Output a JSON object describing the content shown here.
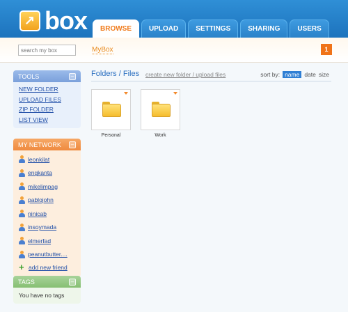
{
  "brand": {
    "name": "box"
  },
  "tabs": [
    "BROWSE",
    "UPLOAD",
    "SETTINGS",
    "SHARING",
    "USERS"
  ],
  "search": {
    "placeholder": "search my box"
  },
  "breadcrumb": "MyBox",
  "notification_count": "1",
  "tools": {
    "title": "TOOLS",
    "items": [
      "NEW FOLDER",
      "UPLOAD FILES",
      "ZIP FOLDER",
      "LIST VIEW"
    ]
  },
  "network": {
    "title": "MY NETWORK",
    "friends": [
      "leonkilat",
      "engkanta",
      "mikelimpag",
      "pablojohn",
      "ninicab",
      "insoymada",
      "elmerfad",
      "peanutbutter...."
    ],
    "add_label": "add new friend"
  },
  "tags": {
    "title": "TAGS",
    "empty_text": "You have no tags"
  },
  "main": {
    "title": "Folders / Files",
    "actions": "create new folder / upload files",
    "sort_label": "sort by:",
    "sort_options": [
      "name",
      "date",
      "size"
    ],
    "sort_selected": "name",
    "folders": [
      "Personal",
      "Work"
    ]
  },
  "colors": {
    "header": "#2580c8",
    "accent": "#f07a1a",
    "link": "#2250a8"
  }
}
